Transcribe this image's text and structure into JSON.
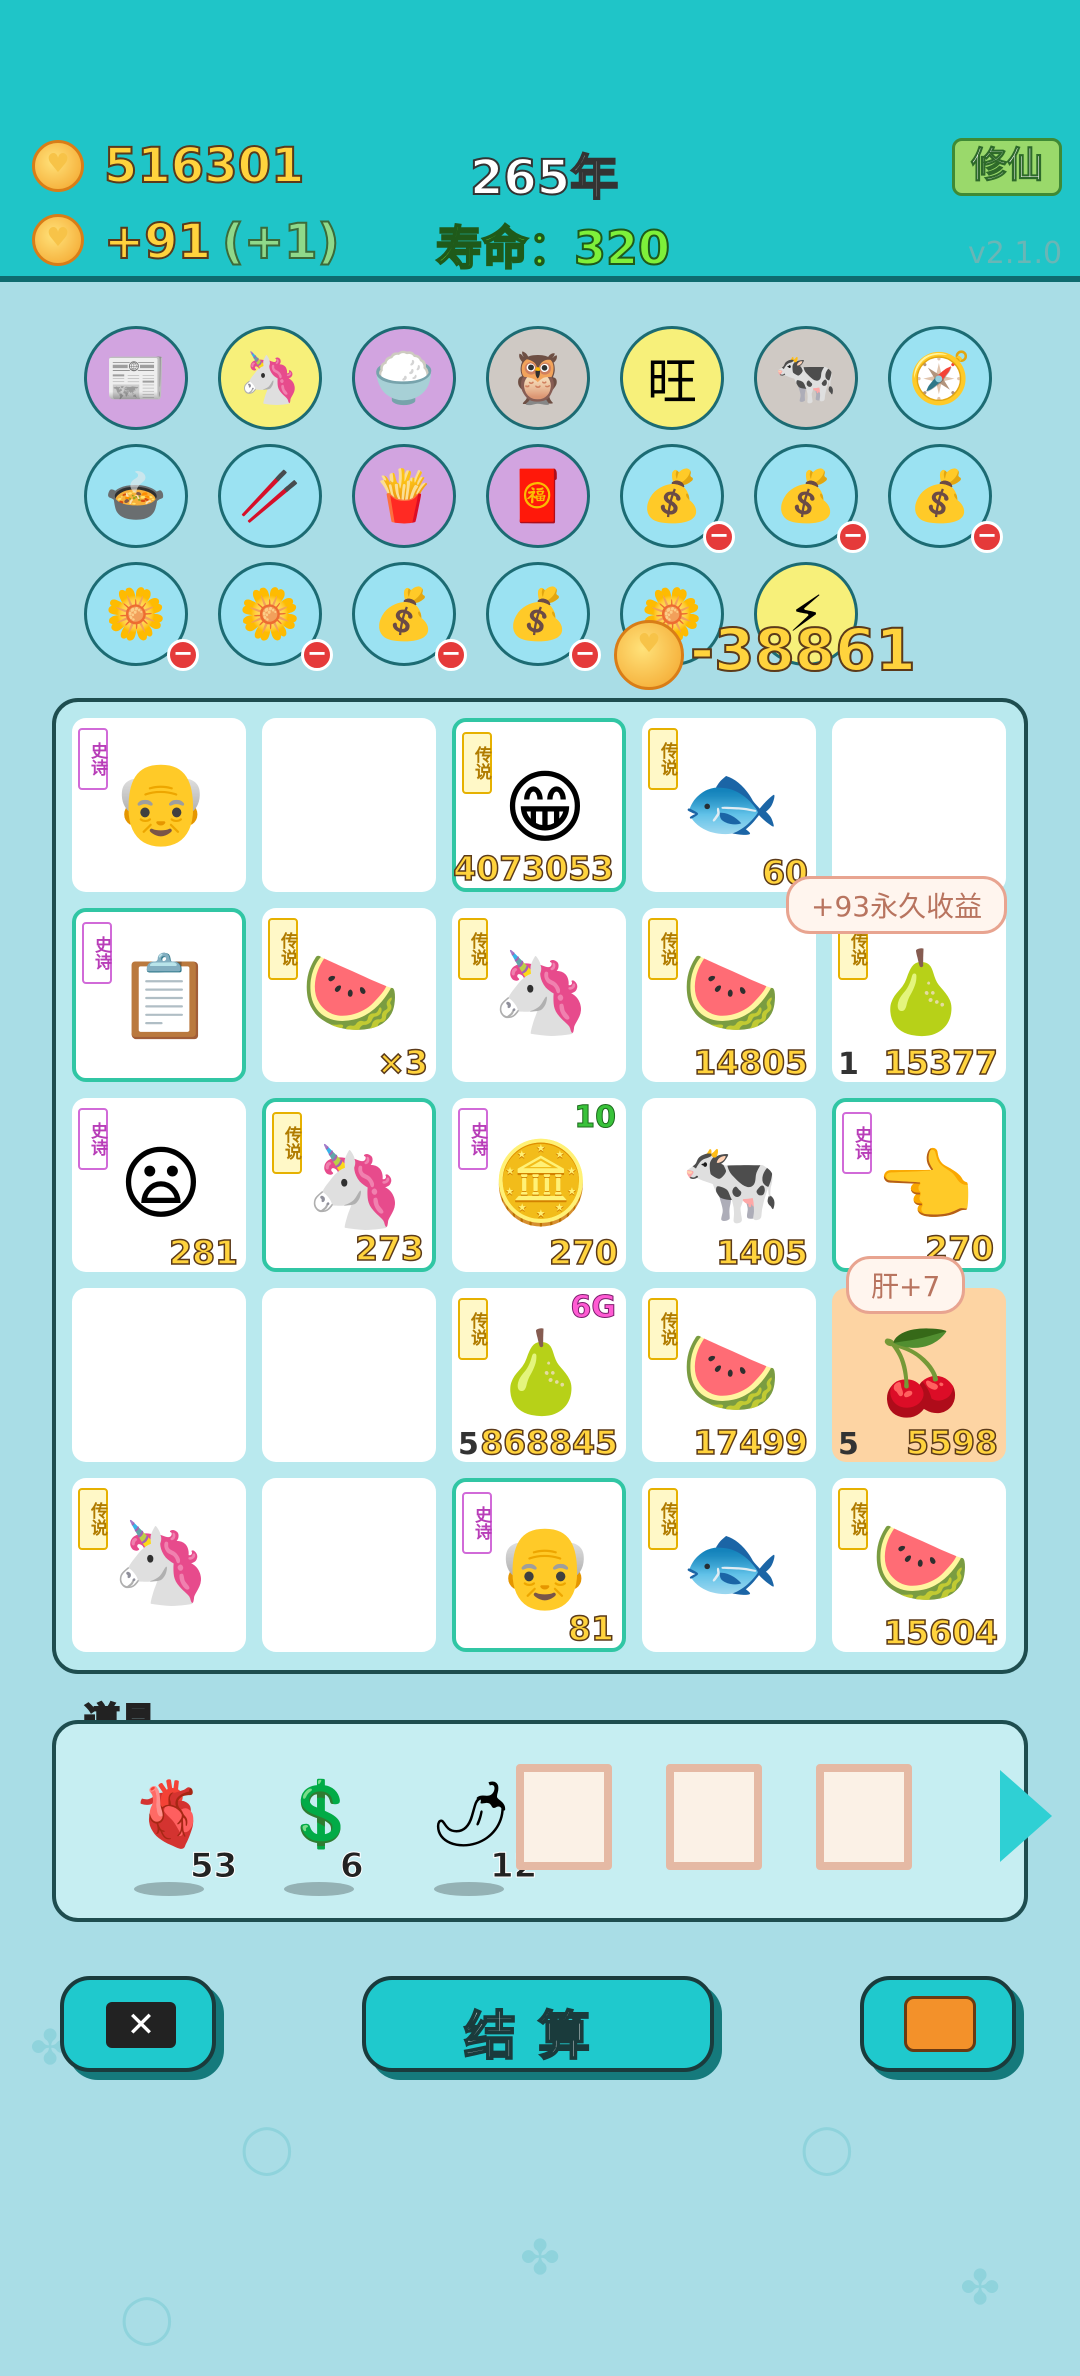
{
  "header": {
    "money": "516301",
    "income": "+91",
    "income_bonus": "(+1)",
    "year": "265年",
    "lifespan": "寿命：320",
    "xiuxian_button": "修仙",
    "version": "v2.1.0"
  },
  "icon_grid": {
    "items": [
      {
        "icon": "time-magazine-icon",
        "color": "purple",
        "glyph": "📰",
        "minus": false
      },
      {
        "icon": "unicorn-icon",
        "color": "yellow",
        "glyph": "🦄",
        "minus": false
      },
      {
        "icon": "rice-bowl-icon",
        "color": "purple",
        "glyph": "🍚",
        "minus": false
      },
      {
        "icon": "owl-glasses-icon",
        "color": "gray",
        "glyph": "🦉",
        "minus": false
      },
      {
        "icon": "wang-tiles-icon",
        "color": "yellow",
        "glyph": "旺",
        "minus": false
      },
      {
        "icon": "two-cows-icon",
        "color": "gray",
        "glyph": "🐄",
        "minus": false
      },
      {
        "icon": "compass-icon",
        "color": "blue",
        "glyph": "🧭",
        "minus": false
      },
      {
        "icon": "pot-duck-icon",
        "color": "blue",
        "glyph": "🍲",
        "minus": false
      },
      {
        "icon": "chopsticks-icon",
        "color": "blue",
        "glyph": "🥢",
        "minus": false
      },
      {
        "icon": "fries-icon",
        "color": "purple",
        "glyph": "🍟",
        "minus": false
      },
      {
        "icon": "red-envelope-icon",
        "color": "purple",
        "glyph": "🧧",
        "minus": false
      },
      {
        "icon": "sack-icon",
        "color": "blue",
        "glyph": "💰",
        "minus": true
      },
      {
        "icon": "sack-icon",
        "color": "blue",
        "glyph": "💰",
        "minus": true
      },
      {
        "icon": "sack-icon",
        "color": "blue",
        "glyph": "💰",
        "minus": true
      },
      {
        "icon": "potted-flower-icon",
        "color": "blue",
        "glyph": "🌼",
        "minus": true
      },
      {
        "icon": "potted-flower-icon",
        "color": "blue",
        "glyph": "🌼",
        "minus": true
      },
      {
        "icon": "sack-icon",
        "color": "blue",
        "glyph": "💰",
        "minus": true
      },
      {
        "icon": "sack-icon",
        "color": "blue",
        "glyph": "💰",
        "minus": true
      },
      {
        "icon": "potted-flower-icon",
        "color": "blue",
        "glyph": "🌼",
        "minus": false
      },
      {
        "icon": "lightning-icon",
        "color": "yellow",
        "glyph": "⚡",
        "minus": false
      }
    ],
    "negative_income": "-38861"
  },
  "board": {
    "cells": [
      {
        "tag": "史诗",
        "tag_style": "purple",
        "icon": "farmer-hat-face-icon",
        "glyph": "👴",
        "count": "",
        "level": "",
        "top": "",
        "highlight": false,
        "orange": false
      },
      {
        "tag": "",
        "tag_style": "",
        "icon": "",
        "glyph": "",
        "count": "",
        "level": "",
        "top": "",
        "highlight": false,
        "orange": false
      },
      {
        "tag": "传说",
        "tag_style": "gold",
        "icon": "bald-grin-face-icon",
        "glyph": "😁",
        "count": "4073053",
        "level": "",
        "top": "",
        "highlight": true,
        "orange": false
      },
      {
        "tag": "传说",
        "tag_style": "gold",
        "icon": "koi-fish-icon",
        "glyph": "🐟",
        "count": "60",
        "level": "",
        "top": "",
        "highlight": false,
        "orange": false
      },
      {
        "tag": "",
        "tag_style": "",
        "icon": "",
        "glyph": "",
        "count": "",
        "level": "",
        "top": "",
        "highlight": false,
        "orange": false
      },
      {
        "tag": "史诗",
        "tag_style": "purple",
        "icon": "ctrl-c-v-icon",
        "glyph": "📋",
        "count": "",
        "level": "",
        "top": "",
        "highlight": true,
        "orange": false
      },
      {
        "tag": "传说",
        "tag_style": "gold",
        "icon": "watermelon-icon",
        "glyph": "🍉",
        "count": "×3",
        "level": "",
        "top": "",
        "highlight": false,
        "orange": false
      },
      {
        "tag": "传说",
        "tag_style": "gold",
        "icon": "unicorn-icon",
        "glyph": "🦄",
        "count": "",
        "level": "",
        "top": "",
        "highlight": false,
        "orange": false
      },
      {
        "tag": "传说",
        "tag_style": "gold",
        "icon": "watermelon-icon",
        "glyph": "🍉",
        "count": "14805",
        "level": "",
        "top": "",
        "highlight": false,
        "orange": false
      },
      {
        "tag": "传说",
        "tag_style": "gold",
        "icon": "pomelo-sparkle-icon",
        "glyph": "🍐",
        "count": "15377",
        "level": "1",
        "top": "",
        "highlight": false,
        "orange": false
      },
      {
        "tag": "史诗",
        "tag_style": "purple",
        "icon": "old-man-glasses-icon",
        "glyph": "😦",
        "count": "281",
        "level": "",
        "top": "",
        "highlight": false,
        "orange": false
      },
      {
        "tag": "传说",
        "tag_style": "gold",
        "icon": "unicorn-icon",
        "glyph": "🦄",
        "count": "273",
        "level": "",
        "top": "",
        "highlight": true,
        "orange": false
      },
      {
        "tag": "史诗",
        "tag_style": "purple",
        "icon": "coin-pie-icon",
        "glyph": "🪙",
        "count": "270",
        "level": "",
        "top": "10",
        "highlight": false,
        "orange": false
      },
      {
        "tag": "",
        "tag_style": "",
        "icon": "cow-icon",
        "glyph": "🐄",
        "count": "1405",
        "level": "",
        "top": "",
        "highlight": false,
        "orange": false
      },
      {
        "tag": "史诗",
        "tag_style": "purple",
        "icon": "pointing-hand-icon",
        "glyph": "👈",
        "count": "270",
        "level": "",
        "top": "",
        "highlight": true,
        "orange": false
      },
      {
        "tag": "",
        "tag_style": "",
        "icon": "",
        "glyph": "",
        "count": "",
        "level": "",
        "top": "",
        "highlight": false,
        "orange": false
      },
      {
        "tag": "",
        "tag_style": "",
        "icon": "",
        "glyph": "",
        "count": "",
        "level": "",
        "top": "",
        "highlight": false,
        "orange": false
      },
      {
        "tag": "传说",
        "tag_style": "gold",
        "icon": "pomelo-sparkle-icon",
        "glyph": "🍐",
        "count": "868845",
        "level": "5",
        "top": "6G",
        "highlight": false,
        "orange": false
      },
      {
        "tag": "传说",
        "tag_style": "gold",
        "icon": "watermelon-icon",
        "glyph": "🍉",
        "count": "17499",
        "level": "",
        "top": "",
        "highlight": false,
        "orange": false
      },
      {
        "tag": "",
        "tag_style": "",
        "icon": "golden-fruits-icon",
        "glyph": "🍒",
        "count": "5598",
        "level": "5",
        "top": "",
        "highlight": false,
        "orange": true
      },
      {
        "tag": "传说",
        "tag_style": "gold",
        "icon": "unicorn-icon",
        "glyph": "🦄",
        "count": "",
        "level": "",
        "top": "",
        "highlight": false,
        "orange": false
      },
      {
        "tag": "",
        "tag_style": "",
        "icon": "",
        "glyph": "",
        "count": "",
        "level": "",
        "top": "",
        "highlight": false,
        "orange": false
      },
      {
        "tag": "史诗",
        "tag_style": "purple",
        "icon": "farmer-hat-face-icon",
        "glyph": "👴",
        "count": "81",
        "level": "",
        "top": "",
        "highlight": true,
        "orange": false
      },
      {
        "tag": "传说",
        "tag_style": "gold",
        "icon": "koi-fish-icon",
        "glyph": "🐟",
        "count": "",
        "level": "",
        "top": "",
        "highlight": false,
        "orange": false
      },
      {
        "tag": "传说",
        "tag_style": "gold",
        "icon": "watermelon-icon",
        "glyph": "🍉",
        "count": "15604",
        "level": "",
        "top": "",
        "highlight": false,
        "orange": false
      }
    ],
    "bubble_income": "+93永久收益",
    "bubble_liver": "肝+7"
  },
  "tools": {
    "title": "道具",
    "items": [
      {
        "icon": "liver-icon",
        "glyph": "🫀",
        "count": "53"
      },
      {
        "icon": "dollar-coin-icon",
        "glyph": "💲",
        "count": "6"
      },
      {
        "icon": "chili-pepper-icon",
        "glyph": "🌶",
        "count": "12"
      }
    ],
    "empty_slots": 3
  },
  "buttons": {
    "cancel_icon": "close-tag-icon",
    "settle_label": "结算",
    "bag_icon": "briefcase-icon"
  }
}
